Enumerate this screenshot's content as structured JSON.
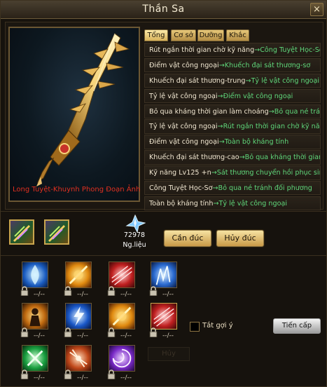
{
  "window": {
    "title": "Thần Sa",
    "close_glyph": "×"
  },
  "tabs": [
    {
      "label": "Tổng",
      "active": true
    },
    {
      "label": "Cơ sở",
      "active": false
    },
    {
      "label": "Dưỡng",
      "active": false
    },
    {
      "label": "Khắc",
      "active": false
    }
  ],
  "weapon": {
    "name": "Long Tuyệt-Khuynh Phong Đoạn Ảnh",
    "name_color": "#e03020"
  },
  "attributes": [
    {
      "a": "Rút ngắn thời gian chờ kỹ năng",
      "arrow": "→",
      "b": "Công Tuyệt Học-Sơ"
    },
    {
      "a": "Điểm vật công ngoại",
      "arrow": "→",
      "b": "Khuếch đại sát thương-sơ"
    },
    {
      "a": "Khuếch đại sát thương-trung",
      "arrow": "→",
      "b": "Tỷ lệ vật công ngoại"
    },
    {
      "a": "Tỷ lệ vật công ngoại",
      "arrow": "→",
      "b": "Điểm vật công ngoại"
    },
    {
      "a": "Bỏ qua kháng thời gian làm choáng",
      "arrow": "→",
      "b": "Bỏ qua né tránh"
    },
    {
      "a": "Tỷ lệ vật công ngoại",
      "arrow": "→",
      "b": "Rút ngắn thời gian chờ kỹ năng"
    },
    {
      "a": "Điểm vật công ngoại",
      "arrow": "→",
      "b": "Toàn bộ kháng tính"
    },
    {
      "a": "Khuếch đại sát thương-cao",
      "arrow": "→",
      "b": "Bỏ qua kháng thời gian t"
    },
    {
      "a": "Kỹ năng Lv125 +n",
      "arrow": "→",
      "b": "Sát thương chuyển hồi phục sinh"
    },
    {
      "a": "Công Tuyệt Học-Sơ",
      "arrow": "→",
      "b": "Bỏ qua né tránh đối phương"
    },
    {
      "a": "Toàn bộ kháng tính",
      "arrow": "→",
      "b": "Tỷ lệ vật công ngoại"
    }
  ],
  "slots": [
    {
      "name": "equipment-slot-1-icon"
    },
    {
      "name": "equipment-slot-2-icon"
    }
  ],
  "material": {
    "icon": "crystal-icon",
    "count": "72978",
    "label": "Ng.liệu"
  },
  "buttons": {
    "refine": "Cần đúc",
    "cancel_refine": "Hủy đúc",
    "advance": "Tiến cấp",
    "faded": "Hủy"
  },
  "checkbox": {
    "label": "Tắt gợi ý",
    "checked": false
  },
  "skills": [
    {
      "icon": "blue-flame-icon",
      "level": "--/--",
      "locked": true
    },
    {
      "icon": "fire-strike-icon",
      "level": "--/--",
      "locked": true
    },
    {
      "icon": "red-slash-icon",
      "level": "--/--",
      "locked": true
    },
    {
      "icon": "ice-shard-icon",
      "level": "--/--",
      "locked": true
    },
    {
      "icon": "warrior-aura-icon",
      "level": "--/--",
      "locked": true
    },
    {
      "icon": "lightning-icon",
      "level": "--/--",
      "locked": true
    },
    {
      "icon": "fire-strike-icon",
      "level": "--/--",
      "locked": true
    },
    {
      "icon": "red-slash-icon",
      "level": "--/--",
      "locked": true
    },
    {
      "icon": "green-cross-icon",
      "level": "--/--",
      "locked": true
    },
    {
      "icon": "blade-dance-icon",
      "level": "--/--",
      "locked": true
    },
    {
      "icon": "purple-vortex-icon",
      "level": "--/--",
      "locked": true
    }
  ],
  "colors": {
    "arrow_green": "#5fd67a",
    "gold": "#c9a64e"
  }
}
